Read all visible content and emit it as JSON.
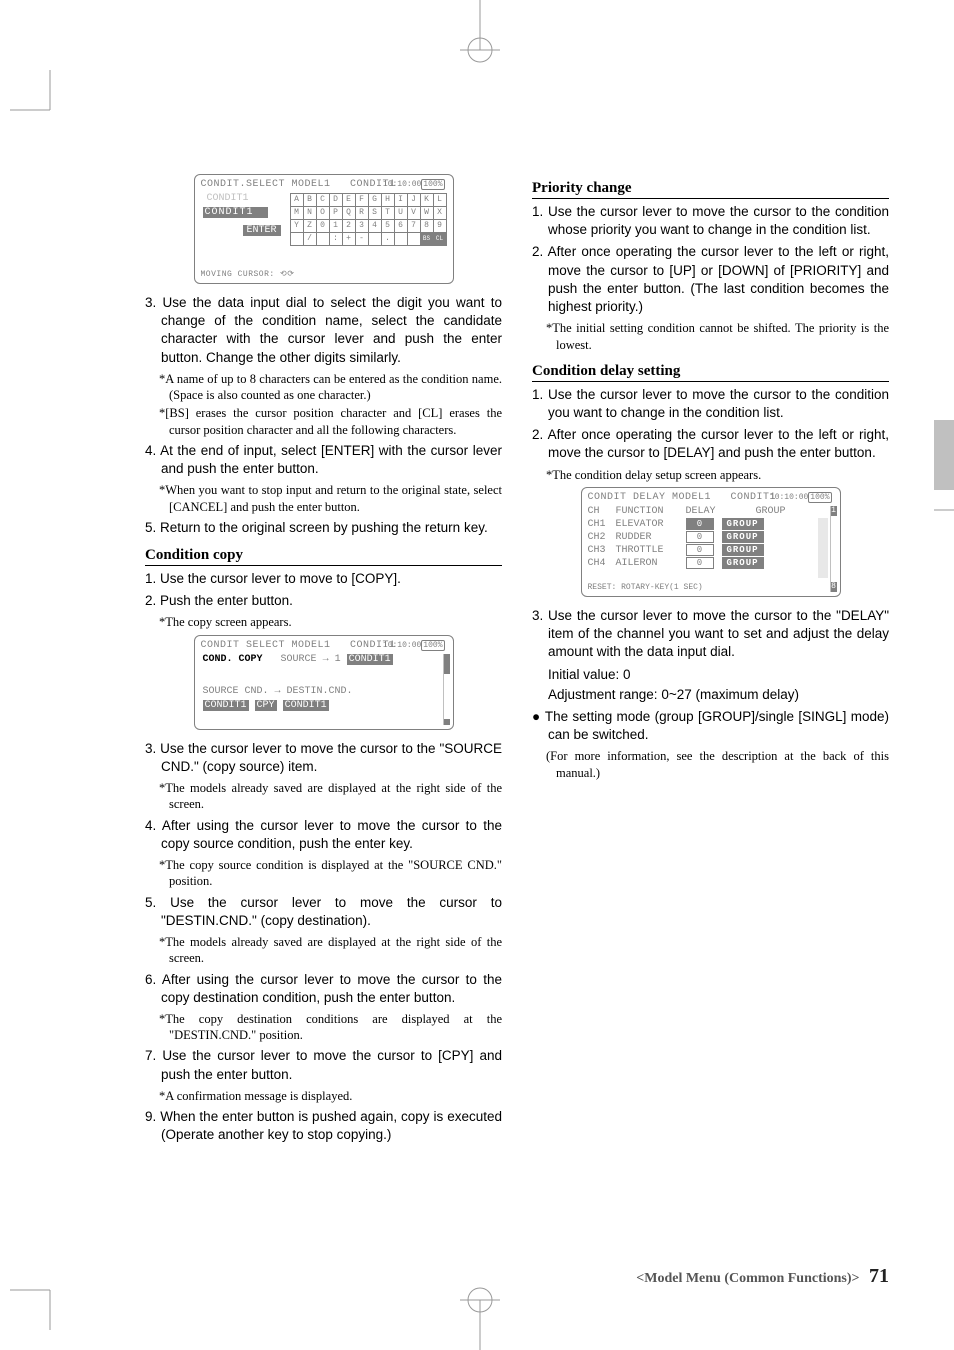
{
  "lcd1": {
    "title": "CONDIT.SELECT MODEL1",
    "title_right": "CONDIT1",
    "time": "10:10:00",
    "batt": "100%",
    "row1_grey": "CONDIT1",
    "row2_inv": "CONDIT1",
    "enter": "ENTER",
    "hint": "MOVING CURSOR: ⟲⟳",
    "grid_r1": [
      "A",
      "B",
      "C",
      "D",
      "E",
      "F",
      "G",
      "H",
      "I",
      "J",
      "K",
      "L"
    ],
    "grid_r2": [
      "M",
      "N",
      "O",
      "P",
      "Q",
      "R",
      "S",
      "T",
      "U",
      "V",
      "W",
      "X"
    ],
    "grid_r3": [
      "Y",
      "Z",
      "0",
      "1",
      "2",
      "3",
      "4",
      "5",
      "6",
      "7",
      "8",
      "9"
    ],
    "grid_r4": [
      "",
      "/",
      "",
      ":",
      "+",
      "-",
      "",
      ".",
      "",
      "",
      "",
      ""
    ]
  },
  "left": {
    "s3": "3. Use the data input dial to select the digit you want to change of the condition name, select the candidate character with the cursor lever and push the enter button. Change the other digits similarly.",
    "n3a": "*A name of up to 8 characters can be entered as the condition name. (Space is also counted as one character.)",
    "n3b": "*[BS] erases the cursor position character and [CL] erases the cursor position character and all the following characters.",
    "s4": "4. At the end of input, select [ENTER] with the cursor lever and push the enter button.",
    "n4": "*When you want to stop input and return to the original state, select [CANCEL] and push the enter button.",
    "s5": "5. Return to the original screen by pushing the return key.",
    "h_cc": "Condition copy",
    "cc1": "1. Use the cursor lever to move to [COPY].",
    "cc2": "2. Push the enter button.",
    "ncc2": "*The copy screen appears.",
    "cc3": "3. Use the cursor lever to move the cursor to the \"SOURCE CND.\" (copy source) item.",
    "ncc3": "*The models already saved are displayed at the right side of the screen.",
    "cc4": "4. After using the cursor lever to move the cursor to the copy source condition, push the enter key.",
    "ncc4": "*The copy source condition is displayed at the \"SOURCE CND.\" position.",
    "cc5": "5. Use the cursor lever to move the cursor to \"DESTIN.CND.\" (copy destination).",
    "ncc5": "*The models already saved are displayed at the right side of the screen.",
    "cc6": "6. After using the cursor lever to move the cursor to the copy destination condition, push the enter button.",
    "ncc6": "*The copy destination conditions are displayed at the \"DESTIN.CND.\" position.",
    "cc7": "7. Use the cursor lever to move the cursor to [CPY] and push the enter button.",
    "ncc7": "*A confirmation message is displayed.",
    "cc9": "9. When the enter button is pushed again, copy is executed (Operate another key to stop copying.)"
  },
  "lcd2": {
    "title": "CONDIT SELECT MODEL1",
    "title_right": "CONDIT1",
    "time": "10:10:00",
    "batt": "100%",
    "bold": "COND. COPY",
    "src_lbl": "SOURCE",
    "arrow": "→",
    "idx": "1",
    "src_val": "CONDIT1",
    "line2": "SOURCE CND. → DESTIN.CND.",
    "src2": "CONDIT1",
    "cpy": "CPY",
    "dst2": "CONDIT1"
  },
  "right": {
    "h_pc": "Priority change",
    "pc1": "1. Use the cursor lever to move the cursor to the condition whose priority you want to change in the condition list.",
    "pc2": "2. After once operating the cursor lever to the left or right, move the cursor to [UP] or [DOWN] of [PRIORITY] and push the enter button. (The last condition becomes the highest priority.)",
    "npc2": "*The initial setting condition cannot be shifted. The priority is the lowest.",
    "h_cd": "Condition delay setting",
    "cd1": "1. Use the cursor lever to move the cursor to the condition you want to change in the condition list.",
    "cd2": "2. After once operating the cursor lever to the left or right, move the cursor to [DELAY] and push the enter button.",
    "ncd2": "*The condition delay setup screen appears.",
    "cd3": "3. Use the cursor lever to move the cursor to the \"DELAY\" item of the channel you want to set and adjust the delay amount with the data input dial.",
    "cd3a": "Initial value: 0",
    "cd3b": "Adjustment range: 0~27 (maximum delay)",
    "bul": "● The setting mode (group [GROUP]/single [SINGL] mode) can be switched.",
    "nbul": "(For more information, see the description at the back of this manual.)"
  },
  "lcd3": {
    "title": "CONDIT DELAY  MODEL1",
    "title_right": "CONDIT1",
    "time": "10:10:00",
    "batt": "100%",
    "col_ch": "CH",
    "col_fn": "FUNCTION",
    "col_dl": "DELAY",
    "col_gp": "GROUP",
    "rows": [
      {
        "ch": "CH1",
        "fn": "ELEVATOR",
        "d": "0",
        "inv": true,
        "g": "GROUP"
      },
      {
        "ch": "CH2",
        "fn": "RUDDER",
        "d": "0",
        "inv": false,
        "g": "GROUP"
      },
      {
        "ch": "CH3",
        "fn": "THROTTLE",
        "d": "0",
        "inv": false,
        "g": "GROUP"
      },
      {
        "ch": "CH4",
        "fn": "AILERON",
        "d": "0",
        "inv": false,
        "g": "GROUP"
      }
    ],
    "hint": "RESET: ROTARY-KEY(1 SEC)",
    "idx_top": "1",
    "idx_bot": "8"
  },
  "footer": {
    "label": "<Model Menu (Common Functions)>",
    "page": "71"
  }
}
